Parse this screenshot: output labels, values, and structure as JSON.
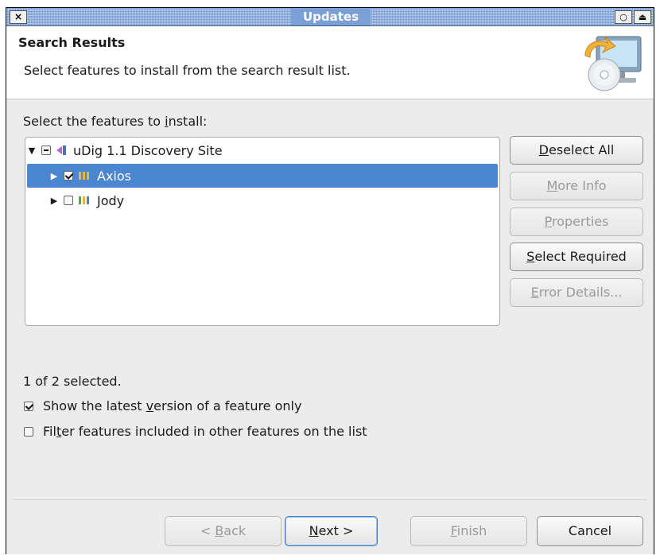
{
  "window": {
    "title": "Updates",
    "close_glyph": "×",
    "restore_glyph": "○",
    "menu_glyph": "⏏"
  },
  "header": {
    "title": "Search Results",
    "description": "Select features to install from the search result list.",
    "image_icon": "update-monitor-cd-icon"
  },
  "tree": {
    "label_parts": [
      "Select the features to ",
      "i",
      "nstall:"
    ],
    "items": [
      {
        "label": "uDig 1.1 Discovery Site",
        "expanded": true,
        "check_state": "mixed",
        "icon": "site-icon",
        "selected": false
      },
      {
        "label": "Axios",
        "expanded": false,
        "check_state": "checked",
        "icon": "feature-icon",
        "selected": true
      },
      {
        "label": "Jody",
        "expanded": false,
        "check_state": "unchecked",
        "icon": "feature-icon",
        "selected": false
      }
    ]
  },
  "side_buttons": {
    "deselect_all": {
      "mnemonic": "D",
      "rest": "eselect All",
      "enabled": true
    },
    "more_info": {
      "mnemonic": "M",
      "rest": "ore Info",
      "enabled": false
    },
    "properties": {
      "mnemonic": "P",
      "rest": "roperties",
      "enabled": false
    },
    "select_required": {
      "mnemonic": "S",
      "rest": "elect Required",
      "enabled": true
    },
    "error_details": {
      "mnemonic": "E",
      "rest": "rror Details...",
      "enabled": false
    }
  },
  "status": "1 of 2 selected.",
  "options": {
    "latest_version": {
      "parts": [
        "Show the latest ",
        "v",
        "ersion of a feature only"
      ],
      "checked": true
    },
    "filter_included": {
      "parts": [
        "Fil",
        "t",
        "er features included in other features on the list"
      ],
      "checked": false
    }
  },
  "bottom_buttons": {
    "back": {
      "prefix": "< ",
      "mnemonic": "B",
      "rest": "ack",
      "enabled": false
    },
    "next": {
      "mnemonic": "N",
      "rest": "ext >",
      "enabled": true,
      "default": true
    },
    "finish": {
      "mnemonic": "F",
      "rest": "inish",
      "enabled": false
    },
    "cancel": {
      "label": "Cancel",
      "enabled": true
    }
  },
  "colors": {
    "selection": "#4a86d1",
    "titlebar": "#6d95cf",
    "disabled_text": "#9a9a9a"
  }
}
